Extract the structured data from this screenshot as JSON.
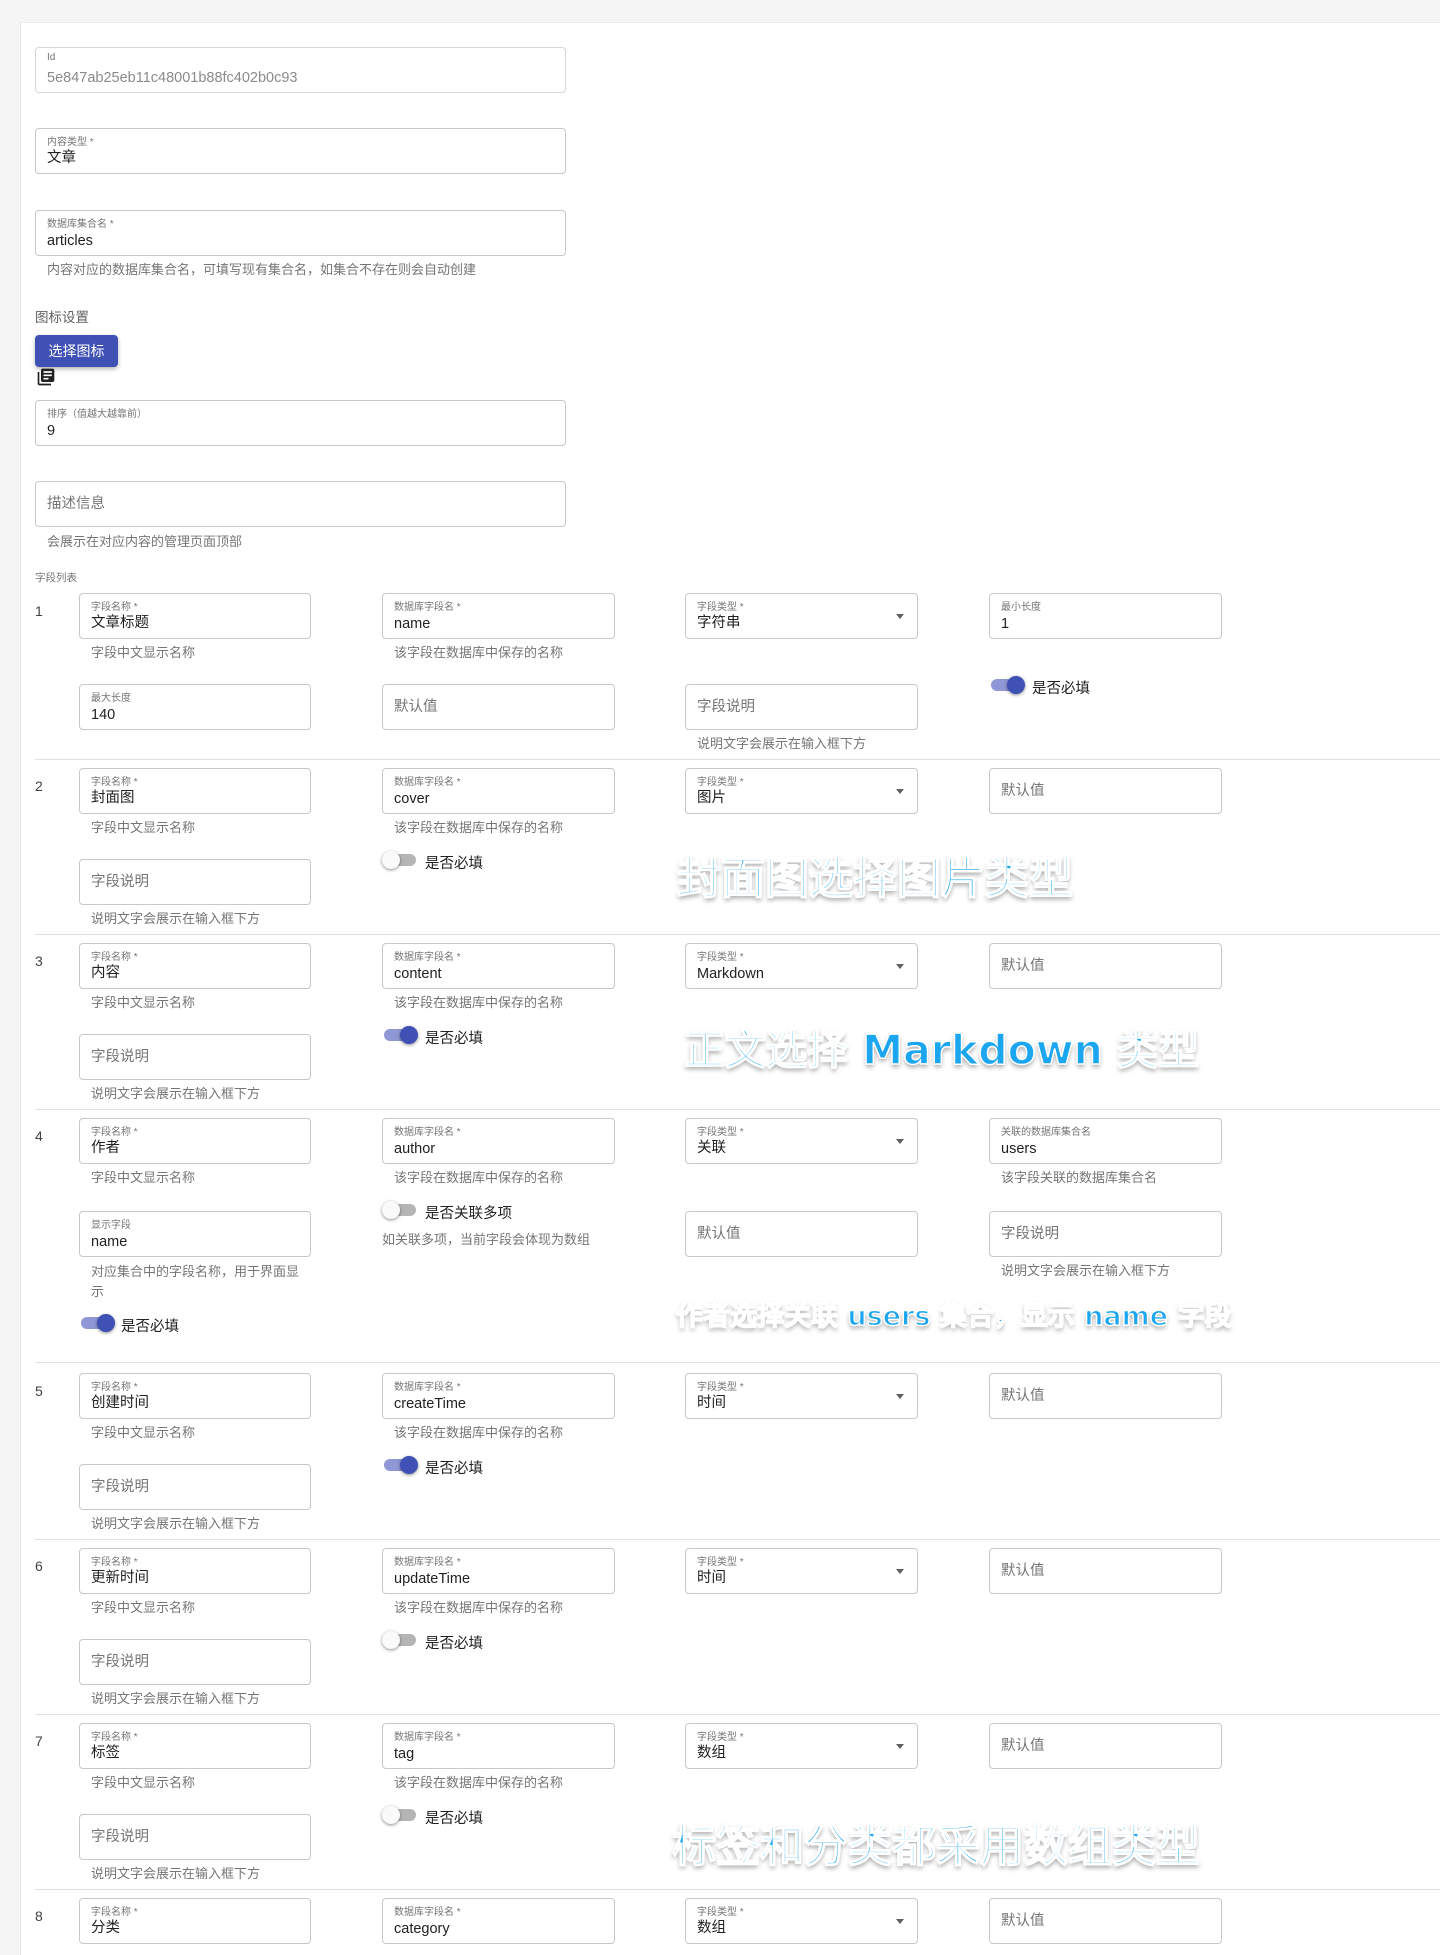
{
  "basic": {
    "id": {
      "label": "Id",
      "value": "5e847ab25eb11c48001b88fc402b0c93"
    },
    "content_type": {
      "label": "内容类型 *",
      "value": "文章"
    },
    "collection": {
      "label": "数据库集合名 *",
      "value": "articles",
      "helper": "内容对应的数据库集合名，可填写现有集合名，如集合不存在则会自动创建"
    },
    "icon_section": "图标设置",
    "choose_icon_button": "选择图标",
    "icon_preview": "library-books-icon",
    "order": {
      "label": "排序（值越大越靠前）",
      "value": "9"
    },
    "description": {
      "placeholder": "描述信息",
      "helper": "会展示在对应内容的管理页面顶部"
    },
    "field_list_label": "字段列表"
  },
  "fields": [
    {
      "index": "1",
      "name": {
        "label": "字段名称 *",
        "value": "文章标题",
        "helper": "字段中文显示名称"
      },
      "db_name": {
        "label": "数据库字段名 *",
        "value": "name",
        "helper": "该字段在数据库中保存的名称"
      },
      "type": {
        "label": "字段类型 *",
        "value": "字符串"
      },
      "min_length": {
        "label": "最小长度",
        "value": "1"
      },
      "max_length": {
        "label": "最大长度",
        "value": "140"
      },
      "default_placeholder": "默认值",
      "desc_placeholder": "字段说明",
      "desc_helper": "说明文字会展示在输入框下方",
      "required": {
        "label": "是否必填",
        "checked": true
      }
    },
    {
      "index": "2",
      "name": {
        "label": "字段名称 *",
        "value": "封面图",
        "helper": "字段中文显示名称"
      },
      "db_name": {
        "label": "数据库字段名 *",
        "value": "cover",
        "helper": "该字段在数据库中保存的名称"
      },
      "type": {
        "label": "字段类型 *",
        "value": "图片"
      },
      "default_placeholder": "默认值",
      "desc_placeholder": "字段说明",
      "desc_helper": "说明文字会展示在输入框下方",
      "required": {
        "label": "是否必填",
        "checked": false
      }
    },
    {
      "index": "3",
      "name": {
        "label": "字段名称 *",
        "value": "内容",
        "helper": "字段中文显示名称"
      },
      "db_name": {
        "label": "数据库字段名 *",
        "value": "content",
        "helper": "该字段在数据库中保存的名称"
      },
      "type": {
        "label": "字段类型 *",
        "value": "Markdown"
      },
      "default_placeholder": "默认值",
      "desc_placeholder": "字段说明",
      "desc_helper": "说明文字会展示在输入框下方",
      "required": {
        "label": "是否必填",
        "checked": true
      }
    },
    {
      "index": "4",
      "name": {
        "label": "字段名称 *",
        "value": "作者",
        "helper": "字段中文显示名称"
      },
      "db_name": {
        "label": "数据库字段名 *",
        "value": "author",
        "helper": "该字段在数据库中保存的名称"
      },
      "type": {
        "label": "字段类型 *",
        "value": "关联"
      },
      "related_collection": {
        "label": "关联的数据库集合名",
        "value": "users",
        "helper": "该字段关联的数据库集合名"
      },
      "display_field": {
        "label": "显示字段",
        "value": "name",
        "helper": "对应集合中的字段名称，用于界面显示"
      },
      "multiple": {
        "label": "是否关联多项",
        "checked": false,
        "helper": "如关联多项，当前字段会体现为数组"
      },
      "default_placeholder": "默认值",
      "desc_placeholder": "字段说明",
      "desc_helper": "说明文字会展示在输入框下方",
      "required": {
        "label": "是否必填",
        "checked": true
      }
    },
    {
      "index": "5",
      "name": {
        "label": "字段名称 *",
        "value": "创建时间",
        "helper": "字段中文显示名称"
      },
      "db_name": {
        "label": "数据库字段名 *",
        "value": "createTime",
        "helper": "该字段在数据库中保存的名称"
      },
      "type": {
        "label": "字段类型 *",
        "value": "时间"
      },
      "default_placeholder": "默认值",
      "desc_placeholder": "字段说明",
      "desc_helper": "说明文字会展示在输入框下方",
      "required": {
        "label": "是否必填",
        "checked": true
      }
    },
    {
      "index": "6",
      "name": {
        "label": "字段名称 *",
        "value": "更新时间",
        "helper": "字段中文显示名称"
      },
      "db_name": {
        "label": "数据库字段名 *",
        "value": "updateTime",
        "helper": "该字段在数据库中保存的名称"
      },
      "type": {
        "label": "字段类型 *",
        "value": "时间"
      },
      "default_placeholder": "默认值",
      "desc_placeholder": "字段说明",
      "desc_helper": "说明文字会展示在输入框下方",
      "required": {
        "label": "是否必填",
        "checked": false
      }
    },
    {
      "index": "7",
      "name": {
        "label": "字段名称 *",
        "value": "标签",
        "helper": "字段中文显示名称"
      },
      "db_name": {
        "label": "数据库字段名 *",
        "value": "tag",
        "helper": "该字段在数据库中保存的名称"
      },
      "type": {
        "label": "字段类型 *",
        "value": "数组"
      },
      "default_placeholder": "默认值",
      "desc_placeholder": "字段说明",
      "desc_helper": "说明文字会展示在输入框下方",
      "required": {
        "label": "是否必填",
        "checked": false
      }
    },
    {
      "index": "8",
      "name": {
        "label": "字段名称 *",
        "value": "分类"
      },
      "db_name": {
        "label": "数据库字段名 *",
        "value": "category"
      },
      "type": {
        "label": "字段类型 *",
        "value": "数组"
      },
      "default_placeholder": "默认值"
    }
  ],
  "annotations": {
    "cover": "封面图选择图片类型",
    "content": "正文选择 Markdown 类型",
    "author": "作者选择关联 users 集合，显示 name 字段",
    "tags": "标签和分类都采用数组类型"
  },
  "colors": {
    "primary": "#3f51b5",
    "annotation": "#1da6f0"
  }
}
